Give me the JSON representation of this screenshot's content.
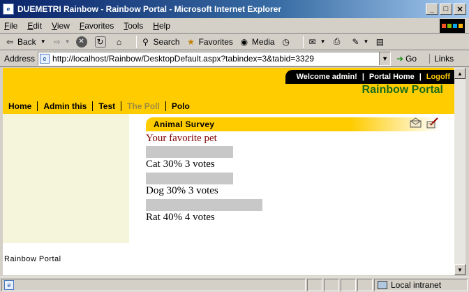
{
  "window": {
    "title": "DUEMETRI Rainbow - Rainbow Portal - Microsoft Internet Explorer"
  },
  "menu": [
    "File",
    "Edit",
    "View",
    "Favorites",
    "Tools",
    "Help"
  ],
  "toolbar": {
    "back_label": "Back",
    "search_label": "Search",
    "favorites_label": "Favorites",
    "media_label": "Media"
  },
  "address": {
    "label": "Address",
    "url": "http://localhost/Rainbow/DesktopDefault.aspx?tabindex=3&tabid=3329",
    "go_label": "Go",
    "links_label": "Links"
  },
  "portal": {
    "welcome": "Welcome admin!",
    "portal_home": "Portal Home",
    "logoff": "Logoff",
    "title": "Rainbow Portal",
    "tabs": [
      "Home",
      "Admin this",
      "Test",
      "The Poll",
      "Polo"
    ],
    "active_tab": "The Poll",
    "footer": "Rainbow Portal"
  },
  "poll": {
    "module_title": "Animal Survey",
    "question": "Your favorite pet",
    "answers": [
      {
        "text": "Cat 30% 3 votes",
        "percent": 30
      },
      {
        "text": "Dog 30% 3 votes",
        "percent": 30
      },
      {
        "text": "Rat 40% 4 votes",
        "percent": 40
      }
    ]
  },
  "status": {
    "zone": "Local intranet"
  },
  "colors": {
    "portal_yellow": "#ffcc00",
    "title_green": "#1a6b1a",
    "question_red": "#800000",
    "bar_gray": "#c8c8c8",
    "left_pane": "#f5f5dc"
  }
}
